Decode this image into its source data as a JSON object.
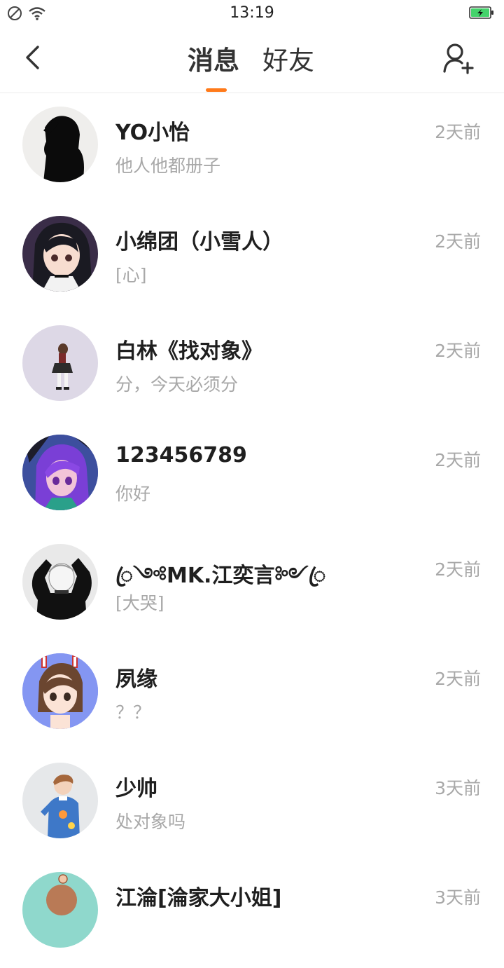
{
  "status_bar": {
    "time": "13:19",
    "icons": [
      "no-disturb-icon",
      "wifi-icon",
      "battery-charging-icon"
    ]
  },
  "header": {
    "back_icon": "back-arrow-icon",
    "tabs": [
      {
        "label": "消息",
        "active": true
      },
      {
        "label": "好友",
        "active": false
      }
    ],
    "add_friend_icon": "add-friend-icon"
  },
  "colors": {
    "accent": "#ff7a1a",
    "battery_fill": "#44d36b",
    "text_primary": "#1f1f1f",
    "text_secondary": "#a8a8a8"
  },
  "conversations": [
    {
      "name": "YO小怡",
      "preview": "他人他都册子",
      "time": "2天前",
      "avatar_bg": "#efeeec"
    },
    {
      "name": "小绵团（小雪人）",
      "preview": "[心]",
      "time": "2天前",
      "avatar_bg": "#d9d3e0"
    },
    {
      "name": "白林《找对象》",
      "preview": "分，今天必须分",
      "time": "2天前",
      "avatar_bg": "#ddd8e6"
    },
    {
      "name": "123456789",
      "preview": "你好",
      "time": "2天前",
      "avatar_bg": "#4a5fb8"
    },
    {
      "name": "ꦿ༺MK.江奕言༻ꦿ",
      "preview": "[大哭]",
      "time": "2天前",
      "avatar_bg": "#e9e9e9"
    },
    {
      "name": "夙缘",
      "preview": "？？",
      "time": "2天前",
      "avatar_bg": "#7a8cf0"
    },
    {
      "name": "少帅",
      "preview": "处对象吗",
      "time": "3天前",
      "avatar_bg": "#e6e8ea"
    },
    {
      "name": "江淪[淪家大小姐]",
      "preview": "",
      "time": "3天前",
      "avatar_bg": "#8fd8cc"
    }
  ]
}
